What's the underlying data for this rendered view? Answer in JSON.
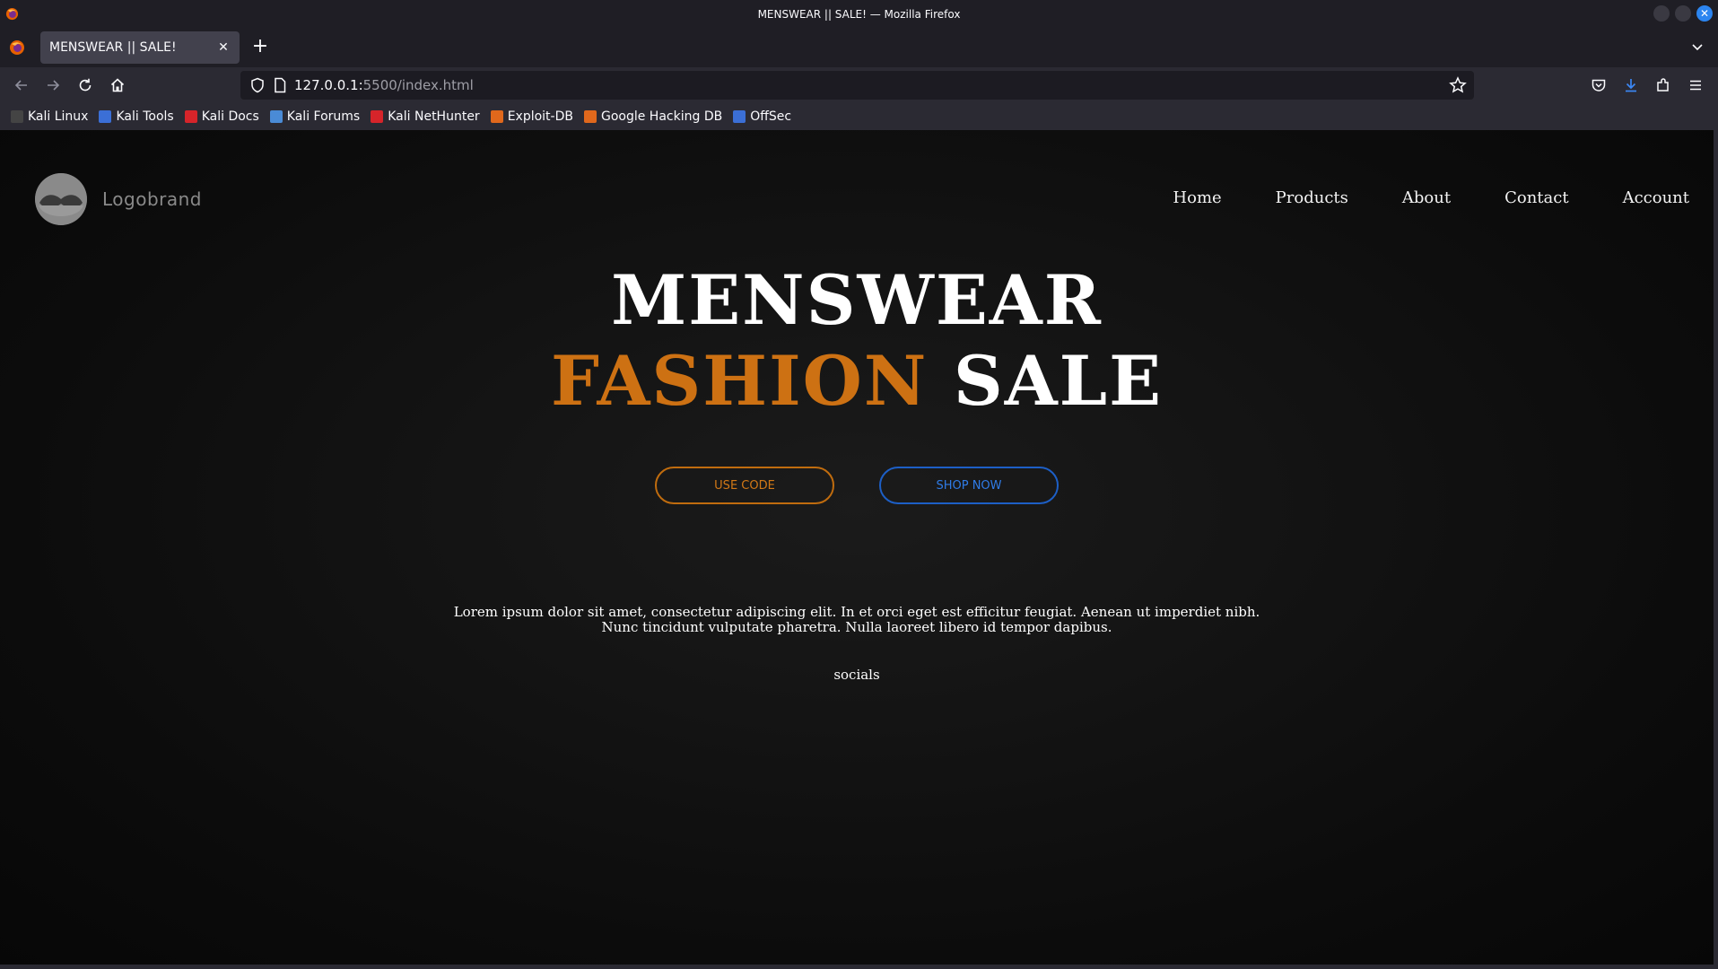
{
  "window": {
    "title": "MENSWEAR || SALE! — Mozilla Firefox"
  },
  "tab": {
    "title": "MENSWEAR || SALE!",
    "close_glyph": "✕",
    "new_tab_glyph": "+"
  },
  "urlbar": {
    "host": "127.0.0.1:",
    "path": "5500/index.html"
  },
  "bookmarks": [
    {
      "label": "Kali Linux",
      "icon": "kali-dragon-icon",
      "color": "#444444"
    },
    {
      "label": "Kali Tools",
      "icon": "kali-tools-icon",
      "color": "#3b6fd6"
    },
    {
      "label": "Kali Docs",
      "icon": "kali-docs-icon",
      "color": "#d6242a"
    },
    {
      "label": "Kali Forums",
      "icon": "kali-forums-icon",
      "color": "#4a8bd6"
    },
    {
      "label": "Kali NetHunter",
      "icon": "kali-nethunter-icon",
      "color": "#d6242a"
    },
    {
      "label": "Exploit-DB",
      "icon": "exploit-db-icon",
      "color": "#e0681c"
    },
    {
      "label": "Google Hacking DB",
      "icon": "ghdb-icon",
      "color": "#e0681c"
    },
    {
      "label": "OffSec",
      "icon": "offsec-icon",
      "color": "#3b6fd6"
    }
  ],
  "site": {
    "logo_text": "Logobrand",
    "menu": [
      "Home",
      "Products",
      "About",
      "Contact",
      "Account"
    ],
    "hero": {
      "line1": "MENSWEAR",
      "line2_accent": "FASHION",
      "line2_rest": "SALE"
    },
    "buttons": {
      "use_code": "USE CODE",
      "shop_now": "SHOP NOW"
    },
    "description": "Lorem ipsum dolor sit amet, consectetur adipiscing elit. In et orci eget est efficitur feugiat. Aenean ut imperdiet nibh. Nunc tincidunt vulputate pharetra. Nulla laoreet libero id tempor dapibus.",
    "socials": "socials"
  },
  "colors": {
    "accent_orange": "#cd7113",
    "accent_blue": "#1d5fc6",
    "page_background": "#0c0c0c"
  }
}
